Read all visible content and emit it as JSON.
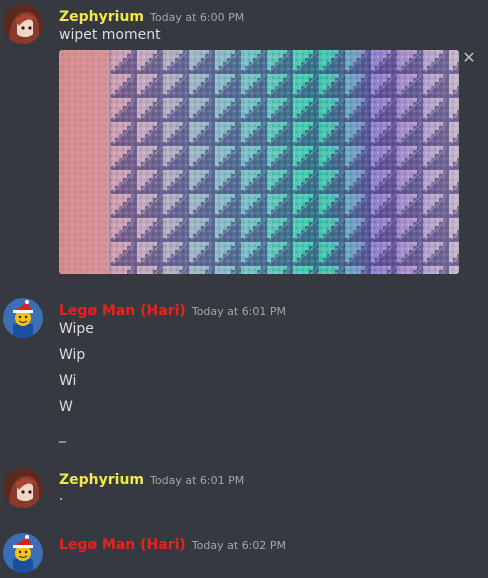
{
  "messages": [
    {
      "author": "Zephyrium",
      "author_color": "#f1e84a",
      "timestamp": "Today at 6:00 PM",
      "lines": [
        "wipet moment"
      ],
      "attachment": "image"
    },
    {
      "author": "Legø Man (Hari)",
      "author_color": "#e8221c",
      "timestamp": "Today at 6:01 PM",
      "lines": [
        "Wipe",
        "Wip",
        "Wi",
        "W",
        "_"
      ]
    },
    {
      "author": "Zephyrium",
      "author_color": "#f1e84a",
      "timestamp": "Today at 6:01 PM",
      "lines": [
        "."
      ]
    },
    {
      "author": "Legø Man (Hari)",
      "author_color": "#e8221c",
      "timestamp": "Today at 6:02 PM",
      "lines": []
    }
  ],
  "icons": {
    "dismiss": "close-icon"
  },
  "colors": {
    "background": "#36393f",
    "text": "#dcddde",
    "timestamp": "#a3a6aa"
  }
}
